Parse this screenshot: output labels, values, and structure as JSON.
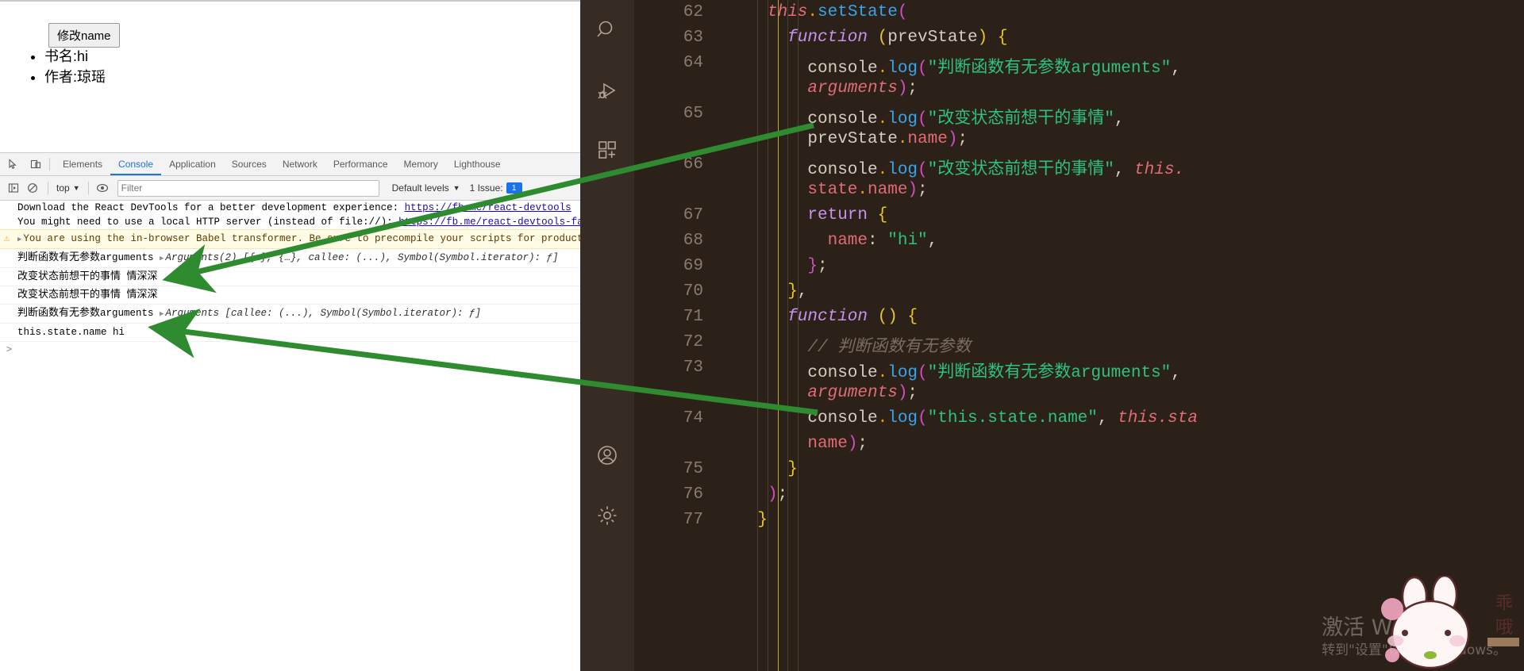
{
  "browser_page": {
    "button_label": "修改name",
    "list_items": [
      "书名:hi",
      "作者:琼瑶"
    ]
  },
  "devtools": {
    "toolbar_icons": [
      "inspect-element-icon",
      "device-toolbar-icon"
    ],
    "tabs": [
      {
        "label": "Elements",
        "active": false
      },
      {
        "label": "Console",
        "active": true
      },
      {
        "label": "Application",
        "active": false
      },
      {
        "label": "Sources",
        "active": false
      },
      {
        "label": "Network",
        "active": false
      },
      {
        "label": "Performance",
        "active": false
      },
      {
        "label": "Memory",
        "active": false
      },
      {
        "label": "Lighthouse",
        "active": false
      }
    ],
    "filterbar": {
      "sidebar_toggle_icon": "console-sidebar-icon",
      "clear_icon": "clear-console-icon",
      "context_value": "top",
      "eye_icon": "live-expression-icon",
      "filter_placeholder": "Filter",
      "levels_value": "Default levels",
      "issues_label": "1 Issue:",
      "issues_count": "1"
    },
    "console_rows": [
      {
        "type": "info",
        "text": "Download the React DevTools for a better development experience: ",
        "link": "https://fb.me/react-devtools"
      },
      {
        "type": "info",
        "text": "You might need to use a local HTTP server (instead of file://): ",
        "link": "https://fb.me/react-devtools-faq"
      },
      {
        "type": "warning",
        "text": "You are using the in-browser Babel transformer. Be sure to precompile your scripts for production"
      },
      {
        "type": "log",
        "label": "判断函数有无参数",
        "mono": "arguments",
        "object": "Arguments(2) [{…}, {…}, callee: (...), Symbol(Symbol.iterator): ƒ]"
      },
      {
        "type": "log",
        "label": "改变状态前想干的事情",
        "value": "情深深"
      },
      {
        "type": "log",
        "label": "改变状态前想干的事情",
        "value": "情深深"
      },
      {
        "type": "log",
        "label": "判断函数有无参数",
        "mono": "arguments",
        "object": "Arguments [callee: (...), Symbol(Symbol.iterator): ƒ]"
      },
      {
        "type": "log",
        "mono": "this.state.name hi"
      }
    ],
    "prompt_caret": ">"
  },
  "vscode": {
    "activity_icons": [
      "search-icon",
      "run-and-debug-icon",
      "extensions-icon",
      "accounts-icon",
      "settings-gear-icon"
    ],
    "first_line_number": 62,
    "lines": [
      {
        "n": 62,
        "tokens": [
          {
            "t": "this",
            "c": "t-this"
          },
          {
            "t": ".",
            "c": "t-dot"
          },
          {
            "t": "setState",
            "c": "t-fn"
          },
          {
            "t": "(",
            "c": "t-paren-p"
          }
        ],
        "indent": 5
      },
      {
        "n": 63,
        "tokens": [
          {
            "t": "function ",
            "c": "t-kw"
          },
          {
            "t": "(",
            "c": "t-paren-y"
          },
          {
            "t": "prevState",
            "c": "t-plain"
          },
          {
            "t": ")",
            "c": "t-paren-y"
          },
          {
            "t": " {",
            "c": "t-paren-y"
          }
        ],
        "indent": 7
      },
      {
        "n": 64,
        "tokens": [
          {
            "t": "console",
            "c": "t-plain"
          },
          {
            "t": ".",
            "c": "t-dot"
          },
          {
            "t": "log",
            "c": "t-fn"
          },
          {
            "t": "(",
            "c": "t-paren-p"
          },
          {
            "t": "\"判断函数有无参数arguments\"",
            "c": "t-str"
          },
          {
            "t": ",",
            "c": "t-plain"
          }
        ],
        "indent": 9
      },
      {
        "n": null,
        "tokens": [
          {
            "t": "arguments",
            "c": "t-ital"
          },
          {
            "t": ")",
            "c": "t-paren-p"
          },
          {
            "t": ";",
            "c": "t-plain"
          }
        ],
        "indent": 9
      },
      {
        "n": 65,
        "tokens": [
          {
            "t": "console",
            "c": "t-plain"
          },
          {
            "t": ".",
            "c": "t-dot"
          },
          {
            "t": "log",
            "c": "t-fn"
          },
          {
            "t": "(",
            "c": "t-paren-p"
          },
          {
            "t": "\"改变状态前想干的事情\"",
            "c": "t-str"
          },
          {
            "t": ",",
            "c": "t-plain"
          }
        ],
        "indent": 9
      },
      {
        "n": null,
        "tokens": [
          {
            "t": "prevState",
            "c": "t-plain"
          },
          {
            "t": ".",
            "c": "t-dot"
          },
          {
            "t": "name",
            "c": "t-prop"
          },
          {
            "t": ")",
            "c": "t-paren-p"
          },
          {
            "t": ";",
            "c": "t-plain"
          }
        ],
        "indent": 9
      },
      {
        "n": 66,
        "tokens": [
          {
            "t": "console",
            "c": "t-plain"
          },
          {
            "t": ".",
            "c": "t-dot"
          },
          {
            "t": "log",
            "c": "t-fn"
          },
          {
            "t": "(",
            "c": "t-paren-p"
          },
          {
            "t": "\"改变状态前想干的事情\"",
            "c": "t-str"
          },
          {
            "t": ", ",
            "c": "t-plain"
          },
          {
            "t": "this.",
            "c": "t-this"
          }
        ],
        "indent": 9
      },
      {
        "n": null,
        "tokens": [
          {
            "t": "state",
            "c": "t-prop"
          },
          {
            "t": ".",
            "c": "t-dot"
          },
          {
            "t": "name",
            "c": "t-prop"
          },
          {
            "t": ")",
            "c": "t-paren-p"
          },
          {
            "t": ";",
            "c": "t-plain"
          }
        ],
        "indent": 9
      },
      {
        "n": 67,
        "tokens": [
          {
            "t": "return ",
            "c": "t-kw2"
          },
          {
            "t": "{",
            "c": "t-paren-y"
          }
        ],
        "indent": 9
      },
      {
        "n": 68,
        "tokens": [
          {
            "t": "name",
            "c": "t-prop"
          },
          {
            "t": ": ",
            "c": "t-plain"
          },
          {
            "t": "\"hi\"",
            "c": "t-str"
          },
          {
            "t": ",",
            "c": "t-plain"
          }
        ],
        "indent": 11
      },
      {
        "n": 69,
        "tokens": [
          {
            "t": "}",
            "c": "t-paren-p"
          },
          {
            "t": ";",
            "c": "t-plain"
          }
        ],
        "indent": 9
      },
      {
        "n": 70,
        "tokens": [
          {
            "t": "}",
            "c": "t-paren-y"
          },
          {
            "t": ",",
            "c": "t-plain"
          }
        ],
        "indent": 7
      },
      {
        "n": 71,
        "tokens": [
          {
            "t": "function ",
            "c": "t-kw"
          },
          {
            "t": "(",
            "c": "t-paren-y"
          },
          {
            "t": ")",
            "c": "t-paren-y"
          },
          {
            "t": " {",
            "c": "t-paren-y"
          }
        ],
        "indent": 7
      },
      {
        "n": 72,
        "tokens": [
          {
            "t": "// 判断函数有无参数",
            "c": "t-comment"
          }
        ],
        "indent": 9
      },
      {
        "n": 73,
        "tokens": [
          {
            "t": "console",
            "c": "t-plain"
          },
          {
            "t": ".",
            "c": "t-dot"
          },
          {
            "t": "log",
            "c": "t-fn"
          },
          {
            "t": "(",
            "c": "t-paren-p"
          },
          {
            "t": "\"判断函数有无参数arguments\"",
            "c": "t-str"
          },
          {
            "t": ",",
            "c": "t-plain"
          }
        ],
        "indent": 9
      },
      {
        "n": null,
        "tokens": [
          {
            "t": "arguments",
            "c": "t-ital"
          },
          {
            "t": ")",
            "c": "t-paren-p"
          },
          {
            "t": ";",
            "c": "t-plain"
          }
        ],
        "indent": 9
      },
      {
        "n": 74,
        "tokens": [
          {
            "t": "console",
            "c": "t-plain"
          },
          {
            "t": ".",
            "c": "t-dot"
          },
          {
            "t": "log",
            "c": "t-fn"
          },
          {
            "t": "(",
            "c": "t-paren-p"
          },
          {
            "t": "\"this.state.name\"",
            "c": "t-str"
          },
          {
            "t": ", ",
            "c": "t-plain"
          },
          {
            "t": "this.sta",
            "c": "t-this"
          }
        ],
        "indent": 9
      },
      {
        "n": null,
        "tokens": [
          {
            "t": "name",
            "c": "t-prop"
          },
          {
            "t": ")",
            "c": "t-paren-p"
          },
          {
            "t": ";",
            "c": "t-plain"
          }
        ],
        "indent": 9
      },
      {
        "n": 75,
        "tokens": [
          {
            "t": "}",
            "c": "t-paren-y"
          }
        ],
        "indent": 7
      },
      {
        "n": 76,
        "tokens": [
          {
            "t": ")",
            "c": "t-paren-p"
          },
          {
            "t": ";",
            "c": "t-plain"
          }
        ],
        "indent": 5
      },
      {
        "n": 77,
        "tokens": [
          {
            "t": "}",
            "c": "t-paren-y"
          }
        ],
        "indent": 4
      }
    ],
    "watermark_line1": "激活 Windows",
    "watermark_line2": "转到\"设置\"以激活 Windows。"
  },
  "colors": {
    "accent_blue": "#1a73e8",
    "devtools_chrome": "#f3f3f3",
    "vscode_bg": "#2b2119",
    "vscode_activity_bg": "#362c23",
    "annotation_green": "#2e8b30"
  }
}
